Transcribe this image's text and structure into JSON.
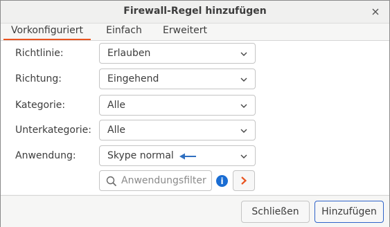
{
  "window": {
    "title": "Firewall-Regel hinzufügen"
  },
  "tabs": [
    {
      "label": "Vorkonfiguriert",
      "active": true
    },
    {
      "label": "Einfach",
      "active": false
    },
    {
      "label": "Erweitert",
      "active": false
    }
  ],
  "form": {
    "policy": {
      "label": "Richtlinie:",
      "value": "Erlauben"
    },
    "direction": {
      "label": "Richtung:",
      "value": "Eingehend"
    },
    "category": {
      "label": "Kategorie:",
      "value": "Alle"
    },
    "subcategory": {
      "label": "Unterkategorie:",
      "value": "Alle"
    },
    "application": {
      "label": "Anwendung:",
      "value": "Skype normal"
    }
  },
  "filter": {
    "placeholder": "Anwendungsfilter",
    "value": ""
  },
  "info_icon_glyph": "i",
  "buttons": {
    "close": "Schließen",
    "add": "Hinzufügen"
  },
  "colors": {
    "accent_tab": "#e95420",
    "info": "#1a6dd3",
    "primary_border": "#2f63c9",
    "annotation_arrow": "#2f6fc0",
    "go_chevron": "#e95420"
  },
  "icons": {
    "close": "close-icon",
    "chevron": "chevron-down-icon",
    "search": "search-icon",
    "info": "info-icon",
    "go": "chevron-right-icon",
    "annotation": "arrow-left-icon"
  }
}
